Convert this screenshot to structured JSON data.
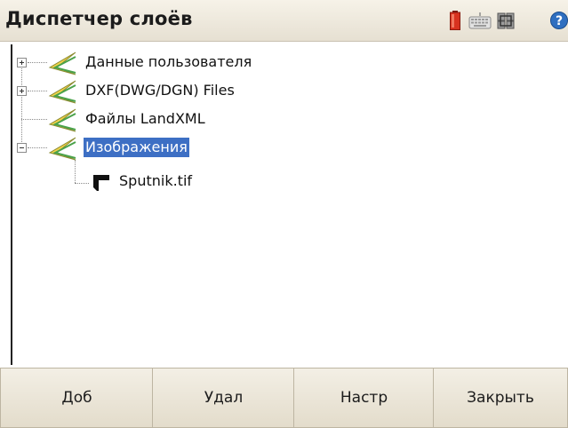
{
  "window": {
    "title": "Диспетчер слоёв"
  },
  "status_bar": {
    "icons": [
      "battery-icon",
      "keyboard-icon",
      "satellite-icon",
      "help-icon"
    ]
  },
  "tree": {
    "nodes": [
      {
        "label": "Данные пользователя",
        "expander": "plus",
        "icon": "layer-icon"
      },
      {
        "label": "DXF(DWG/DGN) Files",
        "expander": "plus",
        "icon": "layer-icon"
      },
      {
        "label": "Файлы LandXML",
        "expander": "none",
        "icon": "layer-icon"
      },
      {
        "label": "Изображения",
        "expander": "minus",
        "icon": "layer-icon",
        "selected": true,
        "children": [
          {
            "label": "Sputnik.tif",
            "icon": "image-file-icon"
          }
        ]
      }
    ]
  },
  "buttons": {
    "add": "Доб",
    "delete": "Удал",
    "settings": "Настр",
    "close": "Закрыть"
  },
  "colors": {
    "selection": "#3d6fc4",
    "titlebar": "#ece7da",
    "button": "#ebe5d7"
  }
}
